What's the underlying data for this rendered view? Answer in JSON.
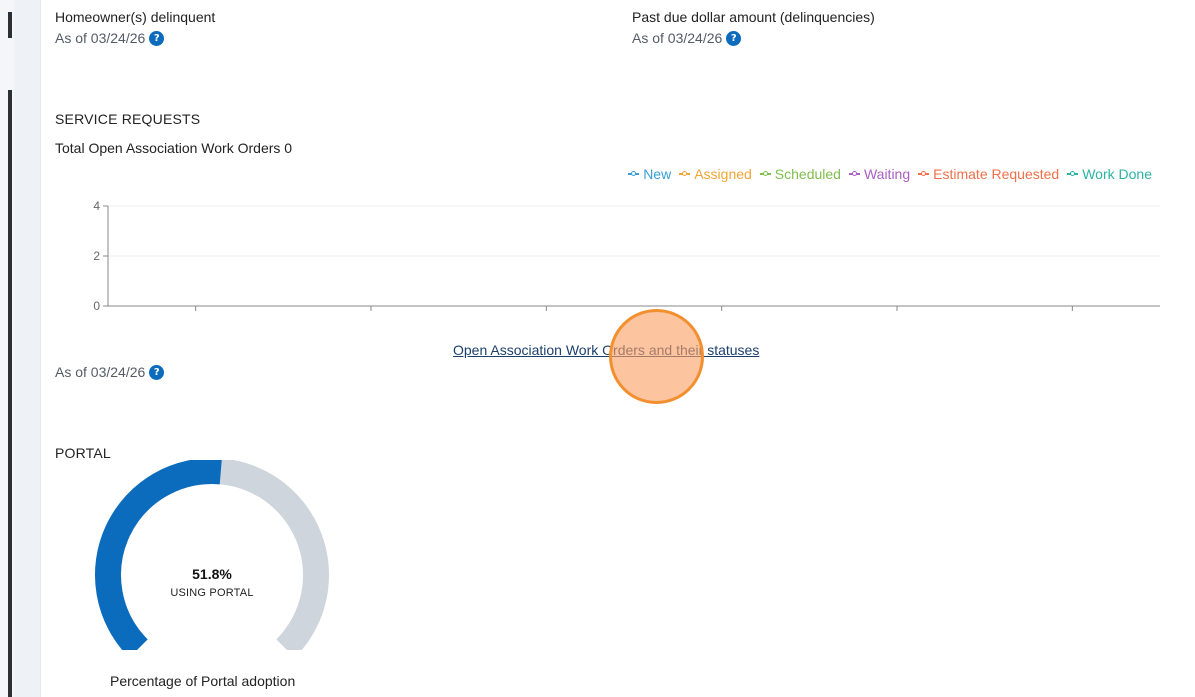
{
  "delinquency": {
    "homeowners_label": "Homeowner(s) delinquent",
    "homeowners_asof": "As of 03/24/26",
    "past_due_label": "Past due dollar amount (delinquencies)",
    "past_due_asof": "As of 03/24/26"
  },
  "service_requests": {
    "title": "SERVICE REQUESTS",
    "total_label": "Total Open Association Work Orders 0",
    "link_label": "Open Association Work Orders and their statuses",
    "asof": "As of 03/24/26",
    "legend": [
      {
        "name": "New",
        "color": "#3a9fd6"
      },
      {
        "name": "Assigned",
        "color": "#f0a535"
      },
      {
        "name": "Scheduled",
        "color": "#7fbf4d"
      },
      {
        "name": "Waiting",
        "color": "#a95fc3"
      },
      {
        "name": "Estimate Requested",
        "color": "#f0704a"
      },
      {
        "name": "Work Done",
        "color": "#2bb3a6"
      }
    ]
  },
  "chart_data": {
    "type": "line",
    "title": "",
    "xlabel": "",
    "ylabel": "",
    "ylim": [
      0,
      4
    ],
    "yticks": [
      "0",
      "2",
      "4"
    ],
    "categories": [
      "",
      "",
      "",
      "",
      "",
      ""
    ],
    "series": [
      {
        "name": "New",
        "values": []
      },
      {
        "name": "Assigned",
        "values": []
      },
      {
        "name": "Scheduled",
        "values": []
      },
      {
        "name": "Waiting",
        "values": []
      },
      {
        "name": "Estimate Requested",
        "values": []
      },
      {
        "name": "Work Done",
        "values": []
      }
    ],
    "grid": true,
    "legend_position": "top-right"
  },
  "portal": {
    "title": "PORTAL",
    "percent_value": 51.8,
    "percent_text": "51.8%",
    "caption": "USING PORTAL",
    "footer": "Percentage of Portal adoption",
    "filled_color": "#0b6cbd",
    "track_color": "#cfd5dc"
  },
  "icons": {
    "help": "question-circle-icon"
  }
}
